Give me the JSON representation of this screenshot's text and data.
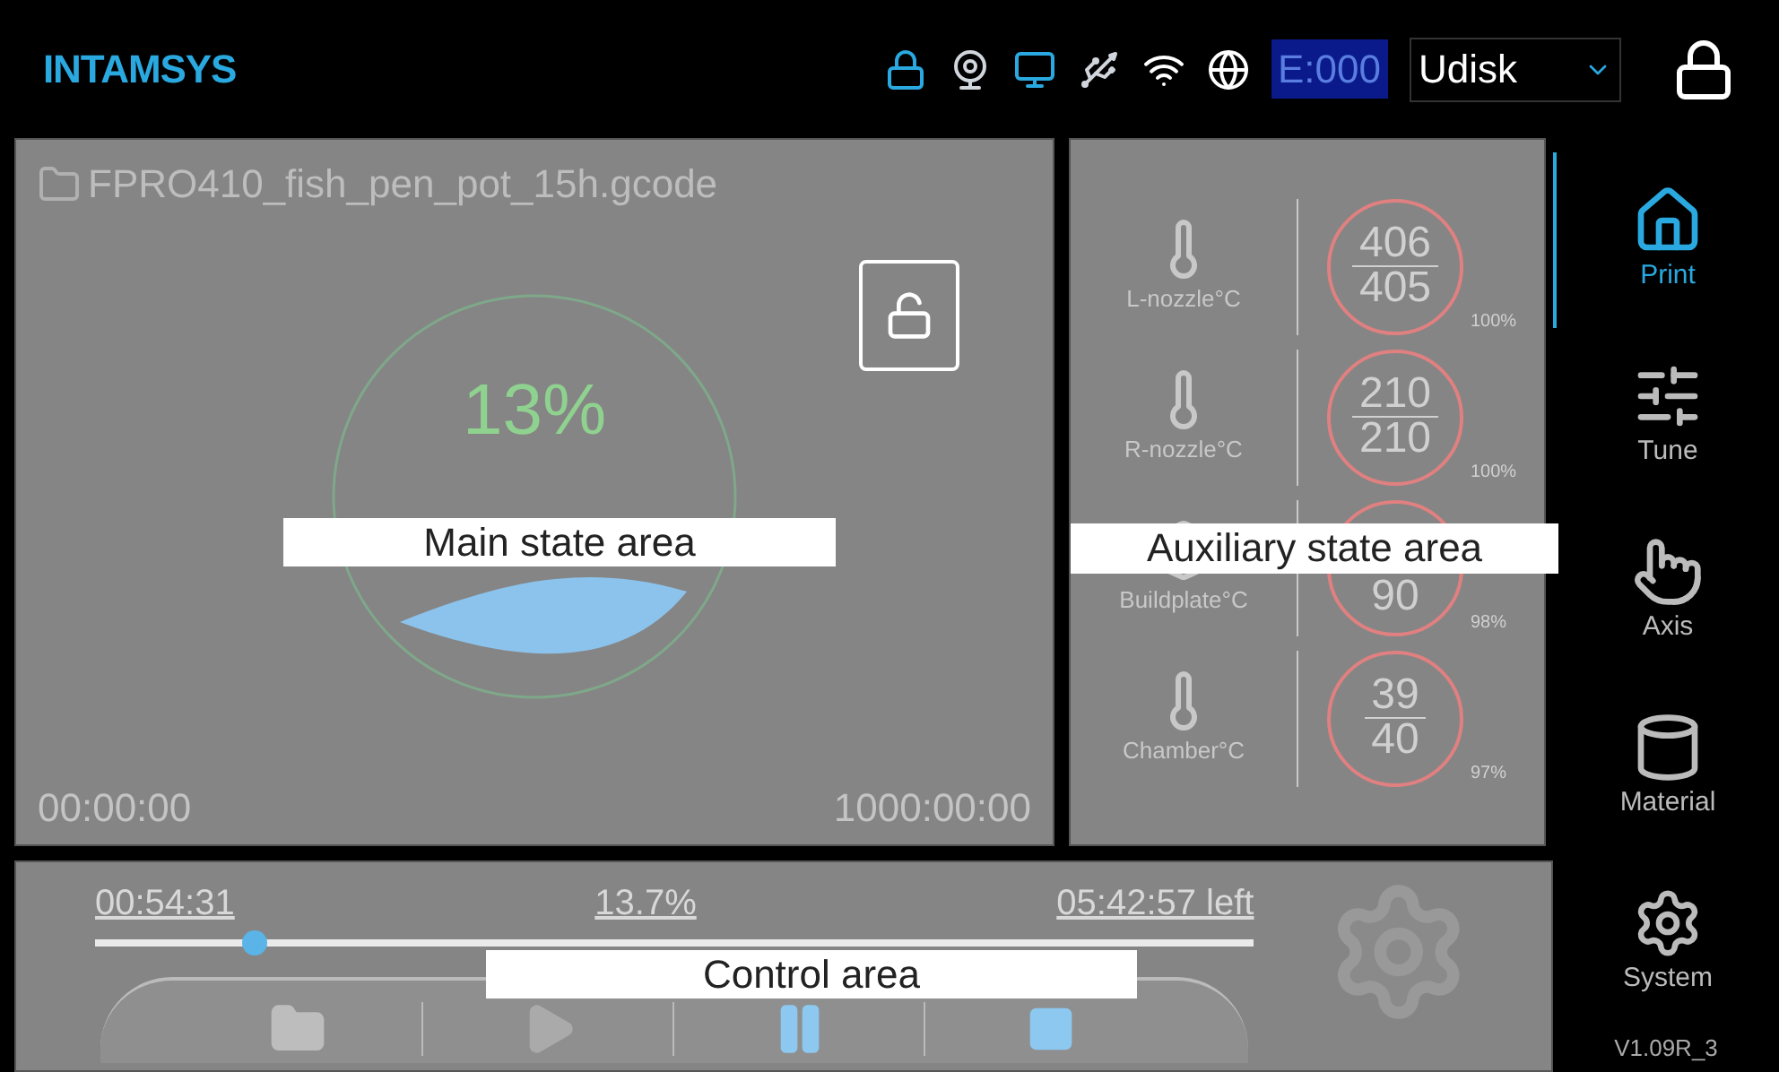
{
  "header": {
    "logo": "INTAMSYS",
    "error_code": "E:000",
    "storage": "Udisk"
  },
  "main": {
    "file_name": "FPRO410_fish_pen_pot_15h.gcode",
    "percent": "13%",
    "elapsed": "00:00:00",
    "total": "1000:00:00"
  },
  "temperatures": [
    {
      "kind": "left-nozzle",
      "label": "L-nozzle°C",
      "target": "406",
      "current": "405",
      "percent": "100%"
    },
    {
      "kind": "right-nozzle",
      "label": "R-nozzle°C",
      "target": "210",
      "current": "210",
      "percent": "100%"
    },
    {
      "kind": "buildplate",
      "label": "Buildplate°C",
      "current": "90",
      "percent": "98%"
    },
    {
      "kind": "chamber",
      "label": "Chamber°C",
      "target": "39",
      "current": "40",
      "percent": "97%"
    }
  ],
  "control": {
    "elapsed": "00:54:31",
    "percent": "13.7%",
    "remaining": "05:42:57 left",
    "level": 0.137
  },
  "sidebar": [
    {
      "kind": "print",
      "label": "Print",
      "selected": true
    },
    {
      "kind": "tune",
      "label": "Tune",
      "selected": false
    },
    {
      "kind": "axis",
      "label": "Axis",
      "selected": false
    },
    {
      "kind": "material",
      "label": "Material",
      "selected": false
    },
    {
      "kind": "system",
      "label": "System",
      "selected": false
    }
  ],
  "version": "V1.09R_3",
  "annotations": [
    "Main state area",
    "Auxiliary state area",
    "Control area"
  ]
}
